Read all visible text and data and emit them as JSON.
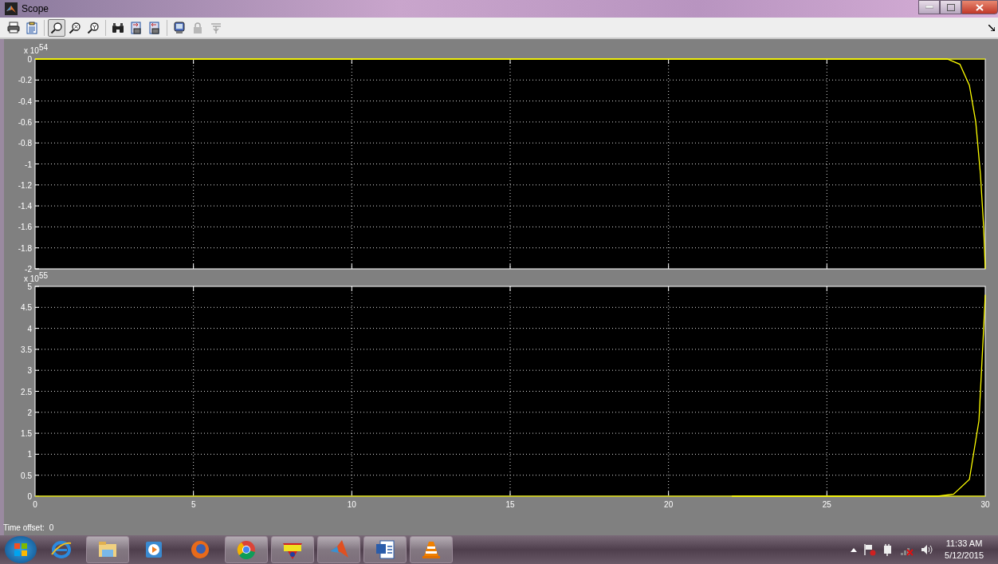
{
  "window": {
    "title": "Scope"
  },
  "toolbar": [
    {
      "selected": false,
      "disabled": false
    },
    {
      "selected": false,
      "disabled": false
    },
    {
      "selected": true,
      "disabled": false
    },
    {
      "selected": false,
      "disabled": false
    },
    {
      "selected": false,
      "disabled": false
    },
    {
      "selected": false,
      "disabled": false
    },
    {
      "selected": false,
      "disabled": false
    },
    {
      "selected": false,
      "disabled": false
    },
    {
      "selected": false,
      "disabled": false
    },
    {
      "selected": false,
      "disabled": true
    },
    {
      "selected": false,
      "disabled": true
    }
  ],
  "plots": [
    {
      "exponent": "x 10$^{54}$",
      "chart_data": {
        "type": "line",
        "grid": true,
        "x": [
          0,
          28,
          28.8,
          29.2,
          29.5,
          29.7,
          29.85,
          29.95,
          30
        ],
        "series": [
          {
            "color": "#ffff00",
            "values": [
              0,
              0,
              0,
              -0.05,
              -0.25,
              -0.6,
              -1.1,
              -1.6,
              -2
            ]
          }
        ],
        "xlim": [
          0,
          30
        ],
        "ylim": [
          -2,
          0
        ],
        "yticks": [
          {
            "value": 0,
            "label": "0"
          },
          {
            "value": -0.2,
            "label": "-0.2"
          },
          {
            "value": -0.4,
            "label": "-0.4"
          },
          {
            "value": -0.6,
            "label": "-0.6"
          },
          {
            "value": -0.8,
            "label": "-0.8"
          },
          {
            "value": -1,
            "label": "-1"
          },
          {
            "value": -1.2,
            "label": "-1.2"
          },
          {
            "value": -1.4,
            "label": "-1.4"
          },
          {
            "value": -1.6,
            "label": "-1.6"
          },
          {
            "value": -1.8,
            "label": "-1.8"
          },
          {
            "value": -2,
            "label": "-2"
          }
        ]
      }
    },
    {
      "exponent": "x 10$^{55}$",
      "chart_data": {
        "type": "line",
        "grid": true,
        "x": [
          22,
          28.5,
          29,
          29.5,
          29.8,
          29.95,
          30
        ],
        "series": [
          {
            "color": "#ffff00",
            "values": [
              0,
              0,
              0.05,
              0.4,
              1.8,
              4,
              4.8
            ]
          }
        ],
        "xlim": [
          0,
          30
        ],
        "ylim": [
          0,
          5
        ],
        "xticks": [
          0,
          5,
          10,
          15,
          20,
          25,
          30
        ],
        "yticks": [
          0,
          0.5,
          1,
          1.5,
          2,
          2.5,
          3,
          3.5,
          4,
          4.5,
          5
        ]
      }
    }
  ],
  "status": {
    "label": "Time offset:",
    "value": "0"
  },
  "taskbar": {
    "apps": [
      {
        "running": false
      },
      {
        "running": true
      },
      {
        "running": false
      },
      {
        "running": false
      },
      {
        "running": true
      },
      {
        "running": true
      },
      {
        "running": true
      },
      {
        "running": true
      },
      {
        "running": true
      }
    ],
    "time": "11:33 AM",
    "date": "5/12/2015"
  }
}
